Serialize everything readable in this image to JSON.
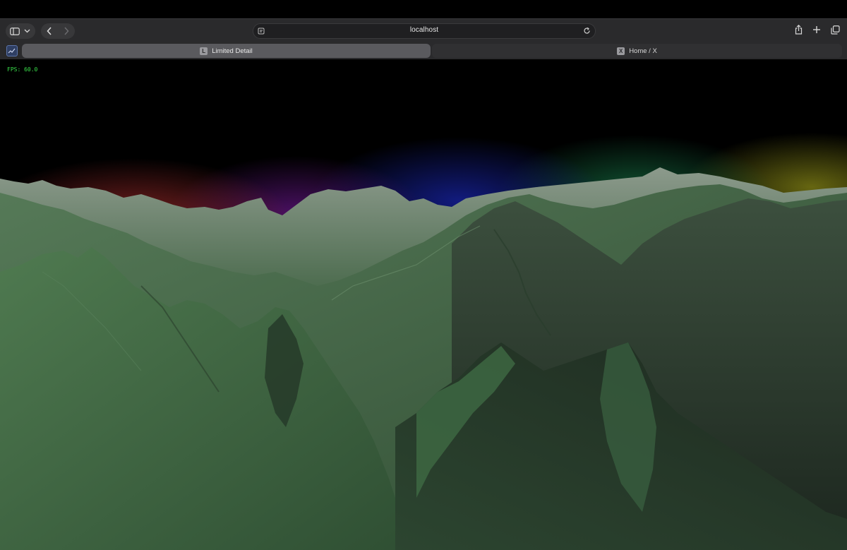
{
  "browser": {
    "address": "localhost",
    "tabs": [
      {
        "label": "Limited Detail",
        "favicon_letter": "L",
        "active": true
      },
      {
        "label": "Home / X",
        "favicon_letter": "X",
        "active": false
      }
    ],
    "icons": {
      "sidebar": "sidebar-icon",
      "sidebar_menu": "chevron-down-icon",
      "back": "chevron-left-icon",
      "forward": "chevron-right-icon",
      "site_settings": "page-settings-icon",
      "reload": "reload-icon",
      "share": "share-icon",
      "new_tab": "plus-icon",
      "tab_overview": "tab-overview-icon"
    }
  },
  "scene": {
    "fps_label": "FPS: 60.0",
    "colors": {
      "terrain": "#3f6b43",
      "fps_text": "#39e04a"
    }
  }
}
